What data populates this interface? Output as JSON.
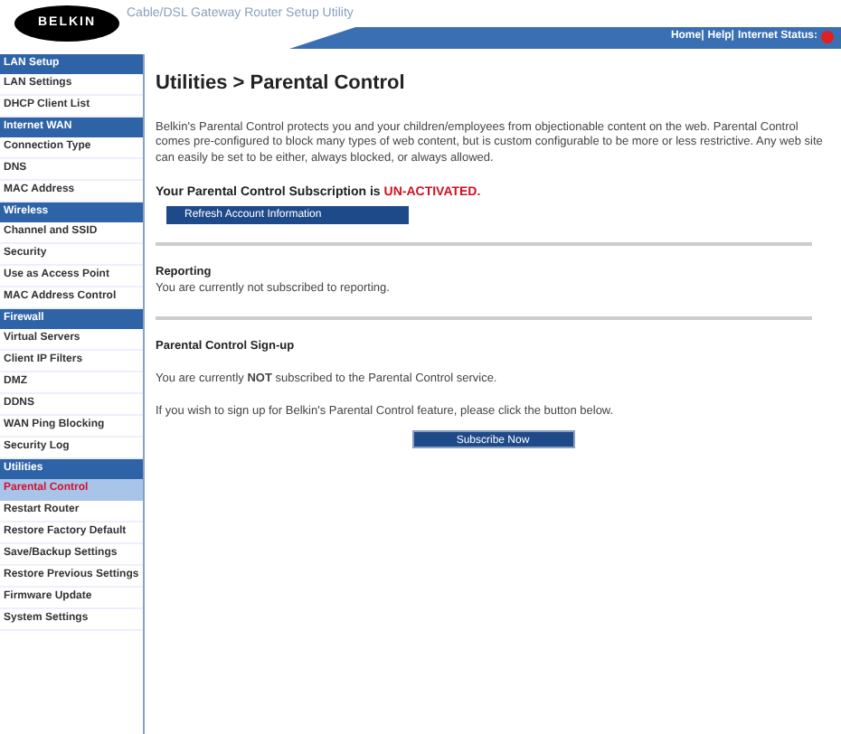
{
  "header": {
    "logo": "BELKIN",
    "title": "Cable/DSL Gateway Router Setup Utility",
    "links": [
      "Home|",
      "Help|",
      "Internet Status:"
    ],
    "internet_connected": false
  },
  "sidebar": {
    "sections": [
      {
        "title": "LAN Setup",
        "items": [
          {
            "label": "LAN Settings",
            "selected": false
          },
          {
            "label": "DHCP Client List",
            "selected": false
          }
        ]
      },
      {
        "title": "Internet WAN",
        "items": [
          {
            "label": "Connection Type",
            "selected": false
          },
          {
            "label": "DNS",
            "selected": false
          },
          {
            "label": "MAC Address",
            "selected": false
          }
        ]
      },
      {
        "title": "Wireless",
        "items": [
          {
            "label": "Channel and SSID",
            "selected": false
          },
          {
            "label": "Security",
            "selected": false
          },
          {
            "label": "Use as Access Point",
            "selected": false
          },
          {
            "label": "MAC Address Control",
            "selected": false
          }
        ]
      },
      {
        "title": "Firewall",
        "items": [
          {
            "label": "Virtual Servers",
            "selected": false
          },
          {
            "label": "Client IP Filters",
            "selected": false
          },
          {
            "label": "DMZ",
            "selected": false
          },
          {
            "label": "DDNS",
            "selected": false
          },
          {
            "label": "WAN Ping Blocking",
            "selected": false
          },
          {
            "label": "Security Log",
            "selected": false
          }
        ]
      },
      {
        "title": "Utilities",
        "items": [
          {
            "label": "Parental Control",
            "selected": true
          },
          {
            "label": "Restart Router",
            "selected": false
          },
          {
            "label": "Restore Factory Default",
            "selected": false
          },
          {
            "label": "Save/Backup Settings",
            "selected": false
          },
          {
            "label": "Restore Previous Settings",
            "selected": false
          },
          {
            "label": "Firmware Update",
            "selected": false
          },
          {
            "label": "System Settings",
            "selected": false
          }
        ]
      }
    ]
  },
  "main": {
    "title": "Utilities > Parental Control",
    "intro": "Belkin's Parental Control protects you and your children/employees from objectionable content on the web. Parental Control comes pre-configured to block many types of web content, but is custom configurable to be more or less restrictive. Any web site can easily be set to be either, always blocked, or always allowed.",
    "subscription": {
      "label": "Your Parental Control Subscription is",
      "status": "UN-ACTIVATED.",
      "button": "Refresh Account Information"
    },
    "reporting": {
      "heading": "Reporting",
      "text": "You are currently not subscribed to reporting."
    },
    "signup": {
      "heading": "Parental Control Sign-up",
      "status": "You are currently **NOT** subscribed to the Parental Control service.",
      "text": "If you wish to sign up for Belkin's Parental Control feature, please click the button below.",
      "button": "Subscribe Now"
    }
  }
}
